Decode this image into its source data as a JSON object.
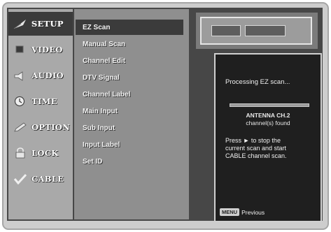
{
  "sidebar": {
    "items": [
      {
        "label": "SETUP",
        "icon": "feather-icon",
        "selected": true
      },
      {
        "label": "VIDEO",
        "icon": "tv-icon",
        "selected": false
      },
      {
        "label": "AUDIO",
        "icon": "speaker-icon",
        "selected": false
      },
      {
        "label": "TIME",
        "icon": "clock-icon",
        "selected": false
      },
      {
        "label": "OPTION",
        "icon": "pencil-icon",
        "selected": false
      },
      {
        "label": "LOCK",
        "icon": "lock-icon",
        "selected": false
      },
      {
        "label": "CABLE",
        "icon": "checkmark-icon",
        "selected": false
      }
    ]
  },
  "menu": {
    "items": [
      {
        "label": "EZ Scan",
        "selected": true
      },
      {
        "label": "Manual Scan",
        "selected": false
      },
      {
        "label": "Channel Edit",
        "selected": false
      },
      {
        "label": "DTV Signal",
        "selected": false
      },
      {
        "label": "Channel Label",
        "selected": false
      },
      {
        "label": "Main Input",
        "selected": false
      },
      {
        "label": "Sub Input",
        "selected": false
      },
      {
        "label": "Input Label",
        "selected": false
      },
      {
        "label": "Set ID",
        "selected": false
      }
    ]
  },
  "dialog": {
    "title": "Processing EZ scan...",
    "source": "ANTENNA CH.2",
    "found": "channel(s) found",
    "message_lines": [
      "Press ► to stop the",
      "current scan and start",
      "CABLE channel scan."
    ],
    "footer_key": "MENU",
    "footer_label": "Previous"
  },
  "colors": {
    "screen": "#474747",
    "sidebar": "#a9a9a9",
    "menu": "#8f8f8f",
    "highlight": "#3b3b3b",
    "dialog": "#1f1f1f",
    "border": "#d0d0d0"
  }
}
